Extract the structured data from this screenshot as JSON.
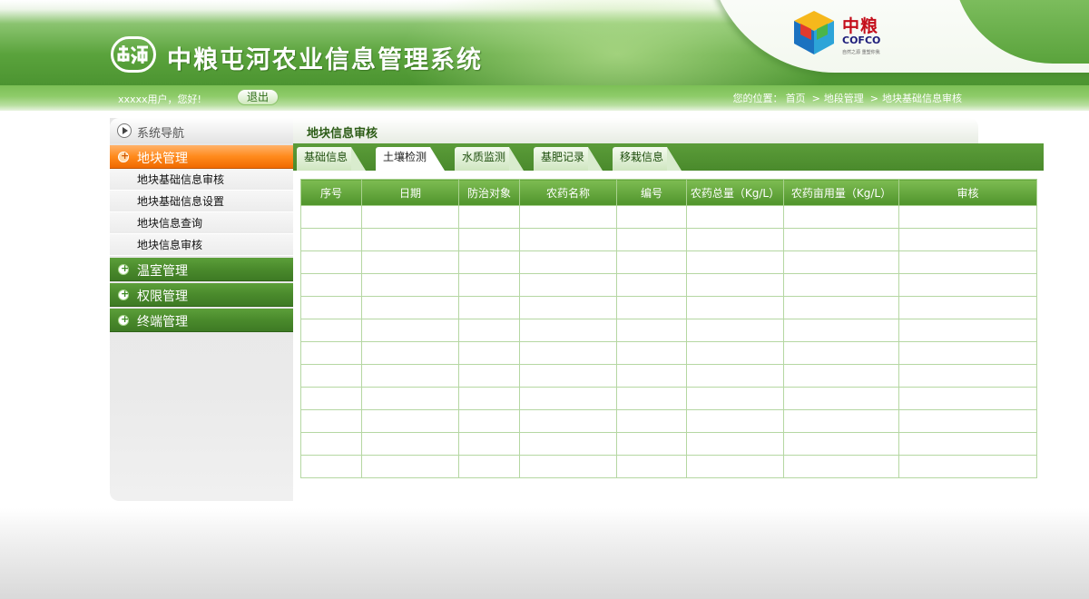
{
  "header": {
    "app_title": "中粮屯河农业信息管理系统",
    "logo_icon": "tunhe-logo-icon",
    "brand_cn": "中粮",
    "brand_en": "COFCO",
    "brand_slogan": "自然之源 重塑你我",
    "brand_icon": "cofco-cube-icon"
  },
  "infobar": {
    "greeting": "xxxxx用户，您好!",
    "logout_label": "退出",
    "location_prefix": "您的位置：",
    "breadcrumb": [
      "首页",
      "地段管理",
      "地块基础信息审核"
    ]
  },
  "sidebar": {
    "title": "系统导航",
    "groups": [
      {
        "label": "地块管理",
        "active": true,
        "items": [
          "地块基础信息审核",
          "地块基础信息设置",
          "地块信息查询",
          "地块信息审核"
        ]
      },
      {
        "label": "温室管理",
        "active": false,
        "items": []
      },
      {
        "label": "权限管理",
        "active": false,
        "items": []
      },
      {
        "label": "终端管理",
        "active": false,
        "items": []
      }
    ]
  },
  "main": {
    "title": "地块信息审核",
    "tabs": [
      {
        "label": "基础信息",
        "active": false
      },
      {
        "label": "土壤检测",
        "active": true
      },
      {
        "label": "水质监测",
        "active": false
      },
      {
        "label": "基肥记录",
        "active": false
      },
      {
        "label": "移栽信息",
        "active": false
      }
    ],
    "table": {
      "columns": [
        "序号",
        "日期",
        "防治对象",
        "农药名称",
        "编号",
        "农药总量（Kg/L）",
        "农药亩用量（Kg/L）",
        "审核"
      ],
      "empty_row_count": 12
    }
  },
  "colors": {
    "header_green": "#5aa33c",
    "active_orange": "#ff8a1c",
    "table_header_green": "#4f932b"
  }
}
